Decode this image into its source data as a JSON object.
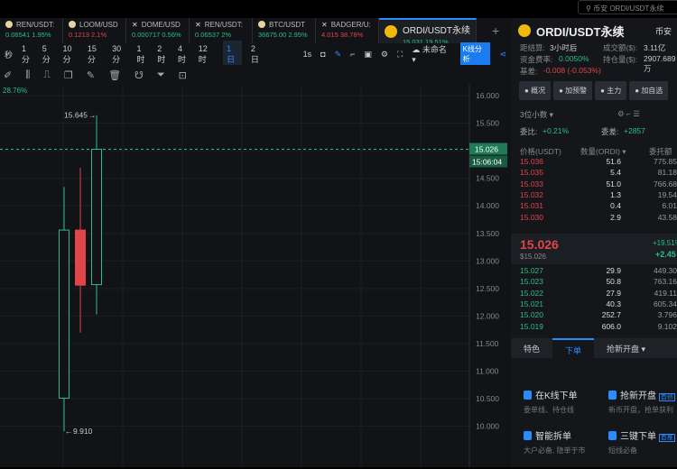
{
  "search": {
    "placeholder": "币安 ORDI/USDT永续"
  },
  "tabs": [
    {
      "name": "REN/USDT:",
      "price": "0.06541",
      "change": "1.95%",
      "dir": "up",
      "icon": "coin"
    },
    {
      "name": "LOOM/USD",
      "price": "0.1213",
      "change": "2.1%",
      "dir": "down",
      "icon": "coin"
    },
    {
      "name": "DOME/USD",
      "price": "0.000717",
      "change": "0.56%",
      "dir": "up",
      "icon": "close"
    },
    {
      "name": "REN/USDT:",
      "price": "0.06537",
      "change": "2%",
      "dir": "up",
      "icon": "close"
    },
    {
      "name": "BTC/USDT",
      "price": "36675.00",
      "change": "2.95%",
      "dir": "up",
      "icon": "coin"
    },
    {
      "name": "BADGER/U:",
      "price": "4.015",
      "change": "38.78%",
      "dir": "down",
      "icon": "close"
    },
    {
      "name": "ORDI/USDT永续",
      "price": "15.031",
      "change": "19.51%",
      "dir": "up",
      "icon": "binance",
      "active": true
    }
  ],
  "intervals": [
    "秒",
    "1分",
    "5分",
    "10分",
    "15分",
    "30分",
    "1时",
    "2时",
    "4时",
    "12时",
    "1日",
    "2日"
  ],
  "selected_interval": "1日",
  "toolbar": {
    "speed": "1s",
    "layout_name": "未命名",
    "analysis": "K线分析"
  },
  "chart": {
    "indicator": "28.76%",
    "current_price": "15.026",
    "countdown": "15:06:04",
    "high_label": "15.645",
    "low_label": "9.910"
  },
  "chart_data": {
    "type": "candlestick",
    "ylim": [
      9.7,
      16.2
    ],
    "y_ticks": [
      "16.000",
      "15.500",
      "15.000",
      "14.500",
      "14.000",
      "13.500",
      "13.000",
      "12.500",
      "12.000",
      "11.500",
      "11.000",
      "10.500",
      "10.000"
    ],
    "candles": [
      {
        "open": 10.51,
        "high": 14.34,
        "low": 9.91,
        "close": 13.56
      },
      {
        "open": 13.56,
        "high": 14.69,
        "low": 11.7,
        "close": 12.56
      },
      {
        "open": 12.57,
        "high": 15.645,
        "low": 12.03,
        "close": 15.026
      }
    ]
  },
  "panel": {
    "symbol": "ORDI/USDT永续",
    "exchange": "币安",
    "settle_label": "距结算:",
    "settle": "3小时后",
    "volume_label": "成交额($):",
    "volume": "3.11亿",
    "funding_label": "资金费率:",
    "funding": "0.0050%",
    "oi_label": "持仓量($):",
    "oi": "2907.689万",
    "basis_label": "基差:",
    "basis": "-0.008 (-0.053%)",
    "buttons": [
      "概况",
      "加预警",
      "主力",
      "加自选"
    ],
    "decimals": "3位小数",
    "ratio_label": "委比:",
    "ratio": "+0.21%",
    "diff_label": "委差:",
    "diff": "+2857",
    "headers": [
      "价格(USDT)",
      "数量(ORDI)",
      "委托额"
    ],
    "asks": [
      [
        "15.036",
        "51.6",
        "775.85"
      ],
      [
        "15.035",
        "5.4",
        "81.18"
      ],
      [
        "15.033",
        "51.0",
        "766.68"
      ],
      [
        "15.032",
        "1.3",
        "19.54"
      ],
      [
        "15.031",
        "0.4",
        "6.01"
      ],
      [
        "15.030",
        "2.9",
        "43.58"
      ]
    ],
    "last_price": "15.026",
    "last_usd": "$15.026",
    "change_pct": "+19.51%",
    "change_abs": "+2.45",
    "bids": [
      [
        "15.027",
        "29.9",
        "449.30"
      ],
      [
        "15.023",
        "50.8",
        "763.16"
      ],
      [
        "15.022",
        "27.9",
        "419.11"
      ],
      [
        "15.021",
        "40.3",
        "605.34"
      ],
      [
        "15.020",
        "252.7",
        "3.796"
      ],
      [
        "15.019",
        "606.0",
        "9.102"
      ]
    ],
    "bottom_tabs": [
      "特色",
      "下单",
      "抢新开盘"
    ],
    "features": [
      {
        "title": "在K线下单",
        "desc": "委单线、持仓线"
      },
      {
        "title": "抢新开盘",
        "badge": "首创",
        "desc": "新币开盘，抢单获利"
      },
      {
        "title": "智能拆单",
        "desc": "大户必备, 隐单于市"
      },
      {
        "title": "三键下单",
        "badge": "首推",
        "desc": "短线必备"
      }
    ]
  }
}
